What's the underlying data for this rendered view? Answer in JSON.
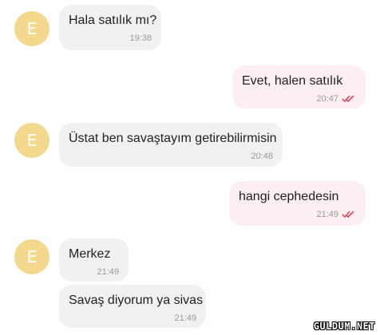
{
  "contact": {
    "avatar_letter": "E",
    "avatar_color": "#f3d88d"
  },
  "messages": [
    {
      "direction": "incoming",
      "text": "Hala satılık mı?",
      "time": "19:38"
    },
    {
      "direction": "outgoing",
      "text": "Evet, halen satılık",
      "time": "20:47",
      "status": "read-double-check-icon"
    },
    {
      "direction": "incoming",
      "text": "Üstat ben savaştayım getirebilirmisin",
      "time": "20:48"
    },
    {
      "direction": "outgoing",
      "text": "hangi cephedesin",
      "time": "21:49",
      "status": "read-double-check-icon"
    },
    {
      "direction": "incoming",
      "text": "Merkez",
      "time": "21:49"
    },
    {
      "direction": "incoming",
      "text": "Savaş diyorum ya sivas",
      "time": "21:49"
    }
  ],
  "colors": {
    "incoming_bubble": "#f1f1f1",
    "outgoing_bubble": "#fbeff1",
    "tick_color": "#e0485e"
  },
  "watermark": "GULDUM.NET"
}
